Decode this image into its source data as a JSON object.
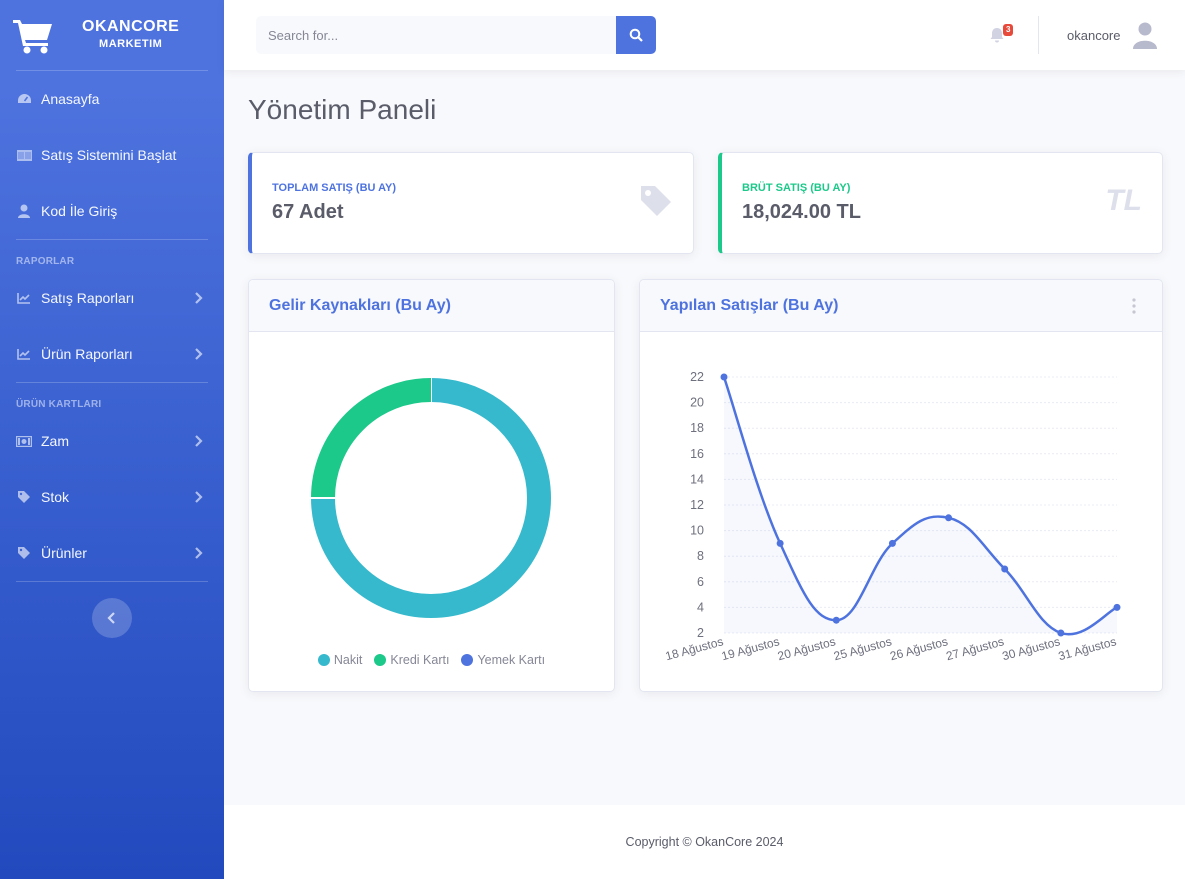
{
  "sidebar": {
    "brand_line1": "OKANCORE",
    "brand_line2": "MARKETIM",
    "items": [
      {
        "label": "Anasayfa",
        "icon": "tachometer-icon"
      },
      {
        "label": "Satış Sistemini Başlat",
        "icon": "barcode-icon"
      },
      {
        "label": "Kod İle Giriş",
        "icon": "user-icon"
      }
    ],
    "heading_reports": "RAPORLAR",
    "report_items": [
      {
        "label": "Satış Raporları",
        "icon": "chart-line-icon"
      },
      {
        "label": "Ürün Raporları",
        "icon": "chart-line-icon"
      }
    ],
    "heading_cards": "ÜRÜN KARTLARI",
    "card_items": [
      {
        "label": "Zam",
        "icon": "money-bill-icon"
      },
      {
        "label": "Stok",
        "icon": "tag-icon"
      },
      {
        "label": "Ürünler",
        "icon": "tag-icon"
      }
    ]
  },
  "topbar": {
    "search_placeholder": "Search for...",
    "notification_count": "3",
    "username": "okancore"
  },
  "page": {
    "title": "Yönetim Paneli"
  },
  "stats": [
    {
      "label": "TOPLAM SATIŞ (BU AY)",
      "value": "67 Adet",
      "icon": "tag-icon"
    },
    {
      "label": "BRÜT SATIŞ (BU AY)",
      "value": "18,024.00 TL",
      "icon": "TL"
    }
  ],
  "cards": {
    "donut_title": "Gelir Kaynakları (Bu Ay)",
    "line_title": "Yapılan Satışlar (Bu Ay)"
  },
  "footer": {
    "copyright": "Copyright © OkanCore 2024"
  },
  "colors": {
    "primary": "#4e73df",
    "success": "#1cc88a",
    "info": "#36b9cc",
    "danger": "#e74a3b"
  },
  "chart_data": [
    {
      "type": "pie",
      "title": "Gelir Kaynakları (Bu Ay)",
      "donut": true,
      "categories": [
        "Nakit",
        "Kredi Kartı",
        "Yemek Kartı"
      ],
      "values": [
        75,
        25,
        0
      ],
      "colors": [
        "#36b9cc",
        "#1cc88a",
        "#4e73df"
      ],
      "legend": "bottom"
    },
    {
      "type": "line",
      "title": "Yapılan Satışlar (Bu Ay)",
      "x": [
        "18 Ağustos",
        "19 Ağustos",
        "20 Ağustos",
        "25 Ağustos",
        "26 Ağustos",
        "27 Ağustos",
        "30 Ağustos",
        "31 Ağustos"
      ],
      "values": [
        22,
        9,
        3,
        9,
        11,
        7,
        2,
        4
      ],
      "ylim": [
        2,
        22
      ],
      "yticks": [
        2,
        4,
        6,
        8,
        10,
        12,
        14,
        16,
        18,
        20,
        22
      ],
      "grid": true,
      "color": "#4e73df"
    }
  ]
}
